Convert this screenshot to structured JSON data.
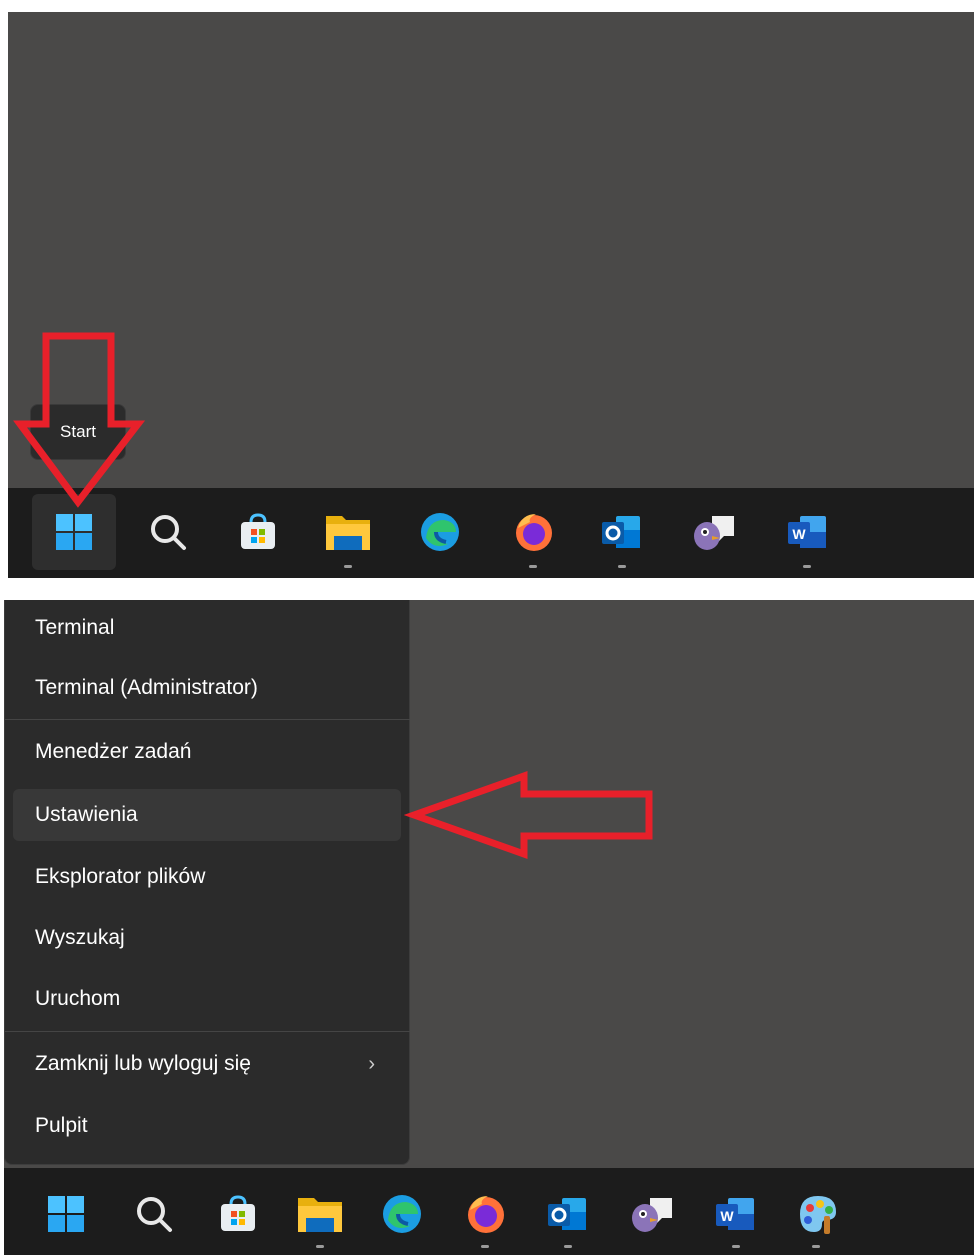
{
  "top": {
    "tooltip_label": "Start",
    "taskbar_icons": [
      {
        "name": "start-icon"
      },
      {
        "name": "search-icon"
      },
      {
        "name": "store-icon"
      },
      {
        "name": "file-explorer-icon"
      },
      {
        "name": "edge-icon"
      },
      {
        "name": "firefox-icon"
      },
      {
        "name": "outlook-icon"
      },
      {
        "name": "pidgin-icon"
      },
      {
        "name": "word-icon"
      }
    ]
  },
  "bottom": {
    "menu_items": [
      {
        "label": "Terminal"
      },
      {
        "label": "Terminal (Administrator)"
      },
      {
        "label": "Menedżer zadań"
      },
      {
        "label": "Ustawienia"
      },
      {
        "label": "Eksplorator plików"
      },
      {
        "label": "Wyszukaj"
      },
      {
        "label": "Uruchom"
      },
      {
        "label": "Zamknij lub wyloguj się"
      },
      {
        "label": "Pulpit"
      }
    ],
    "submenu_chevron": "›",
    "taskbar_icons": [
      {
        "name": "start-icon"
      },
      {
        "name": "search-icon"
      },
      {
        "name": "store-icon"
      },
      {
        "name": "file-explorer-icon"
      },
      {
        "name": "edge-icon"
      },
      {
        "name": "firefox-icon"
      },
      {
        "name": "outlook-icon"
      },
      {
        "name": "pidgin-icon"
      },
      {
        "name": "word-icon"
      },
      {
        "name": "paint-icon"
      }
    ]
  },
  "colors": {
    "desktop": "#4a4948",
    "taskbar": "#1c1c1c",
    "menu": "#2b2b2b",
    "annotation_arrow": "#e8202a"
  }
}
